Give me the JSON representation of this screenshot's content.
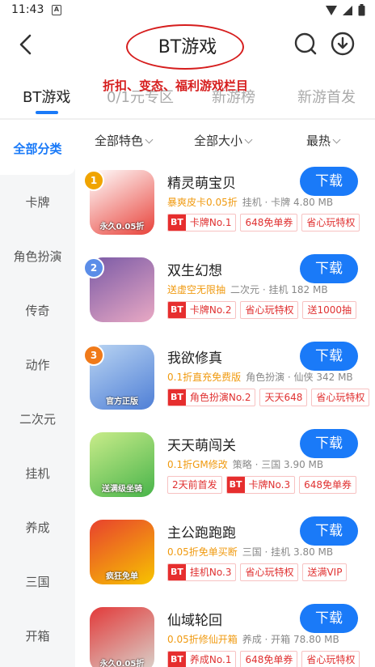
{
  "status": {
    "time": "11:43",
    "notif_glyph": "A"
  },
  "header": {
    "title": "BT游戏"
  },
  "annotation": "折扣、变态、福利游戏栏目",
  "tabs": [
    {
      "label": "BT游戏",
      "active": true
    },
    {
      "label": "0/1元专区"
    },
    {
      "label": "新游榜"
    },
    {
      "label": "新游首发"
    }
  ],
  "sidebar": [
    {
      "label": "全部分类",
      "active": true
    },
    {
      "label": "卡牌"
    },
    {
      "label": "角色扮演"
    },
    {
      "label": "传奇"
    },
    {
      "label": "动作"
    },
    {
      "label": "二次元"
    },
    {
      "label": "挂机"
    },
    {
      "label": "养成"
    },
    {
      "label": "三国"
    },
    {
      "label": "开箱"
    }
  ],
  "filters": [
    {
      "label": "全部特色"
    },
    {
      "label": "全部大小"
    },
    {
      "label": "最热"
    }
  ],
  "games": [
    {
      "rank": "1",
      "name": "精灵萌宝贝",
      "promo": "暴爽皮卡0.05折",
      "meta": "挂机 · 卡牌  4.80 MB",
      "icon_label": "永久0.05折",
      "icon_colors": [
        "#e8423a",
        "#ffffff"
      ],
      "tags": [
        {
          "bt": "BT",
          "text": "卡牌No.1"
        },
        {
          "text": "648免单券"
        },
        {
          "text": "省心玩特权"
        }
      ],
      "download": "下载"
    },
    {
      "rank": "2",
      "name": "双生幻想",
      "promo": "送虚空无限抽",
      "meta": "二次元 · 挂机  182 MB",
      "icon_label": "",
      "icon_colors": [
        "#e9a9c4",
        "#7a5aa6"
      ],
      "tags": [
        {
          "bt": "BT",
          "text": "卡牌No.2"
        },
        {
          "text": "省心玩特权"
        },
        {
          "text": "送1000抽"
        }
      ],
      "download": "下载"
    },
    {
      "rank": "3",
      "name": "我欲修真",
      "promo": "0.1折直充免费版",
      "meta": "角色扮演 · 仙侠  342 MB",
      "icon_label": "官方正版",
      "icon_colors": [
        "#4f7fd6",
        "#b9d4f2"
      ],
      "tags": [
        {
          "bt": "BT",
          "text": "角色扮演No.2"
        },
        {
          "text": "天天648"
        },
        {
          "text": "省心玩特权"
        }
      ],
      "download": "下载"
    },
    {
      "rank": "",
      "name": "天天萌闯关",
      "promo": "0.1折GM修改",
      "meta": "策略 · 三国  3.90 MB",
      "icon_label": "送满级坐骑",
      "icon_colors": [
        "#48b44a",
        "#c9ec8a"
      ],
      "tags": [
        {
          "text": "2天前首发"
        },
        {
          "bt": "BT",
          "text": "卡牌No.3"
        },
        {
          "text": "648免单券"
        }
      ],
      "download": "下载"
    },
    {
      "rank": "",
      "name": "主公跑跑跑",
      "promo": "0.05折免单买断",
      "meta": "三国 · 挂机  3.80 MB",
      "icon_label": "疯狂免单",
      "icon_colors": [
        "#f7c400",
        "#e8412e"
      ],
      "tags": [
        {
          "bt": "BT",
          "text": "挂机No.3"
        },
        {
          "text": "省心玩特权"
        },
        {
          "text": "送满VIP"
        }
      ],
      "download": "下载"
    },
    {
      "rank": "",
      "name": "仙域轮回",
      "promo": "0.05折修仙开箱",
      "meta": "养成 · 开箱  78.80 MB",
      "icon_label": "永久0.05折",
      "icon_colors": [
        "#d9d3cc",
        "#e23a3a"
      ],
      "tags": [
        {
          "bt": "BT",
          "text": "养成No.1"
        },
        {
          "text": "648免单券"
        },
        {
          "text": "省心玩特权"
        }
      ],
      "download": "下载"
    }
  ]
}
